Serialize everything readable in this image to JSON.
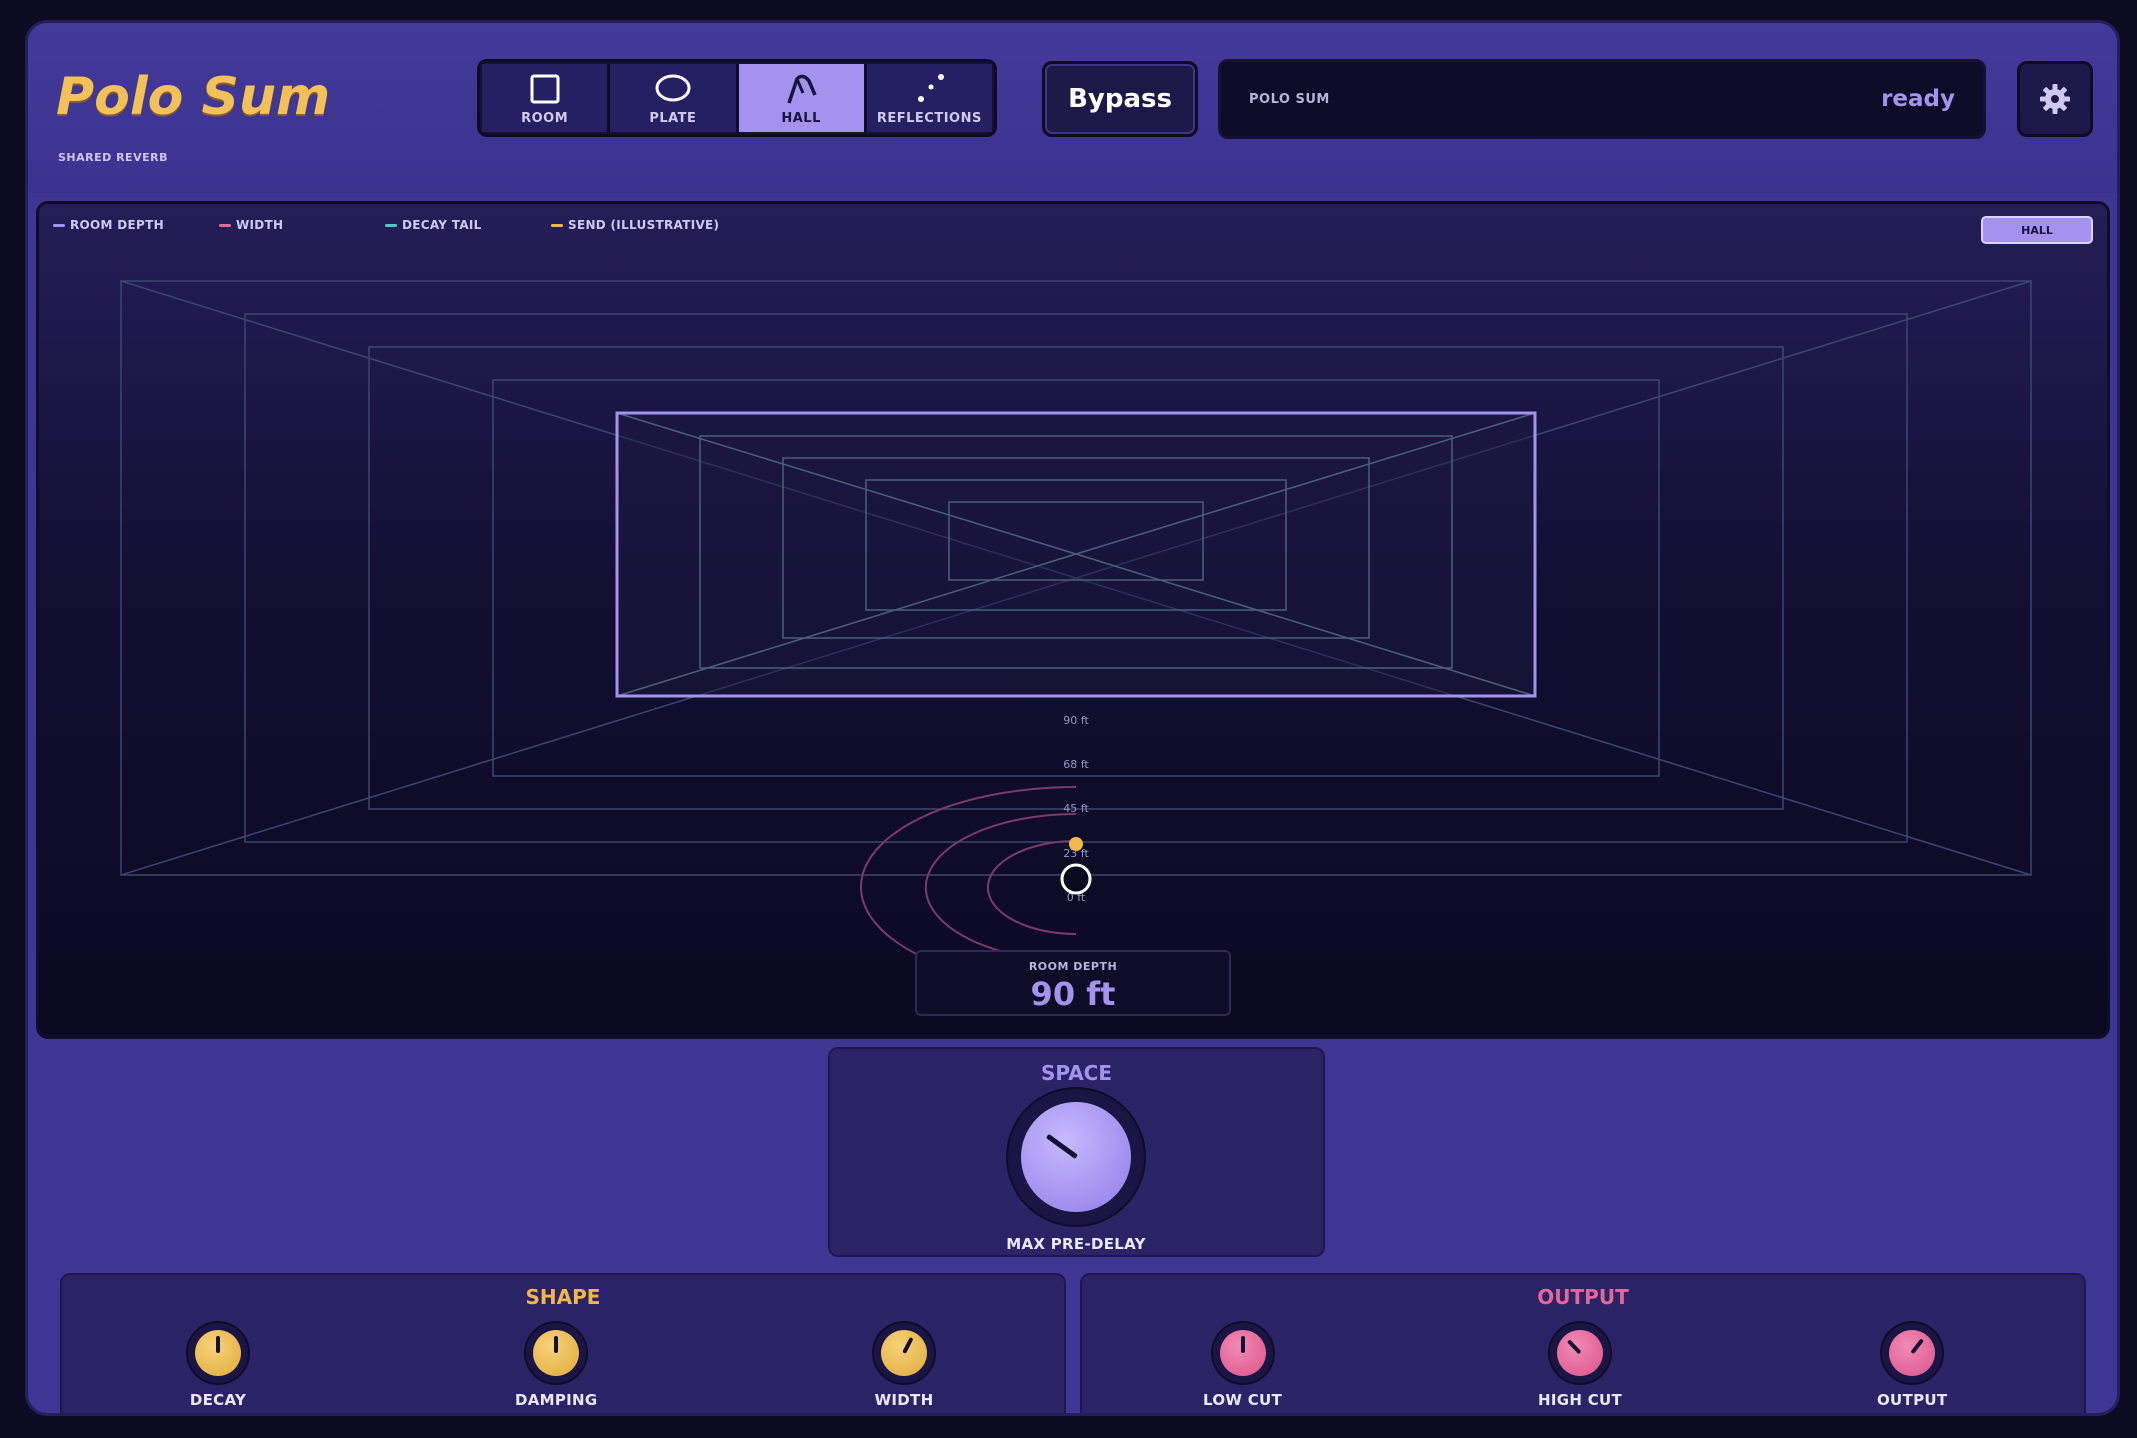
{
  "header": {
    "title": "Polo Sum",
    "subtitle": "SHARED REVERB",
    "modes": [
      {
        "label": "ROOM",
        "icon": "square-icon",
        "active": false
      },
      {
        "label": "PLATE",
        "icon": "ellipse-icon",
        "active": false
      },
      {
        "label": "HALL",
        "icon": "hall-icon",
        "active": true
      },
      {
        "label": "REFLECTIONS",
        "icon": "dots-icon",
        "active": false
      }
    ],
    "bypass_label": "Bypass",
    "status_name": "POLO SUM",
    "status_state": "ready",
    "settings_icon": "gear-icon"
  },
  "viz": {
    "legend": [
      {
        "label": "ROOM DEPTH",
        "color": "#a493ee"
      },
      {
        "label": "WIDTH",
        "color": "#e2679a"
      },
      {
        "label": "DECAY TAIL",
        "color": "#58c7c0"
      },
      {
        "label": "SEND (ILLUSTRATIVE)",
        "color": "#f2b64a"
      }
    ],
    "mode_badge": "HALL",
    "depth_ticks": [
      "90 ft",
      "68 ft",
      "45 ft",
      "23 ft",
      "0 ft"
    ],
    "depth_label": "ROOM DEPTH",
    "depth_value": "90 ft"
  },
  "space": {
    "title": "SPACE",
    "knob_label": "MAX PRE-DELAY",
    "value": 0.3
  },
  "shape": {
    "title": "SHAPE",
    "knobs": [
      {
        "label": "DECAY",
        "value": 0.5
      },
      {
        "label": "DAMPING",
        "value": 0.5
      },
      {
        "label": "WIDTH",
        "value": 0.6
      }
    ]
  },
  "output": {
    "title": "OUTPUT",
    "knobs": [
      {
        "label": "LOW CUT",
        "value": 0.5
      },
      {
        "label": "HIGH CUT",
        "value": 0.34
      },
      {
        "label": "OUTPUT",
        "value": 0.64
      }
    ]
  },
  "colors": {
    "accent": "#a493ee",
    "gold": "#f2b64a",
    "pink": "#e2679a"
  }
}
